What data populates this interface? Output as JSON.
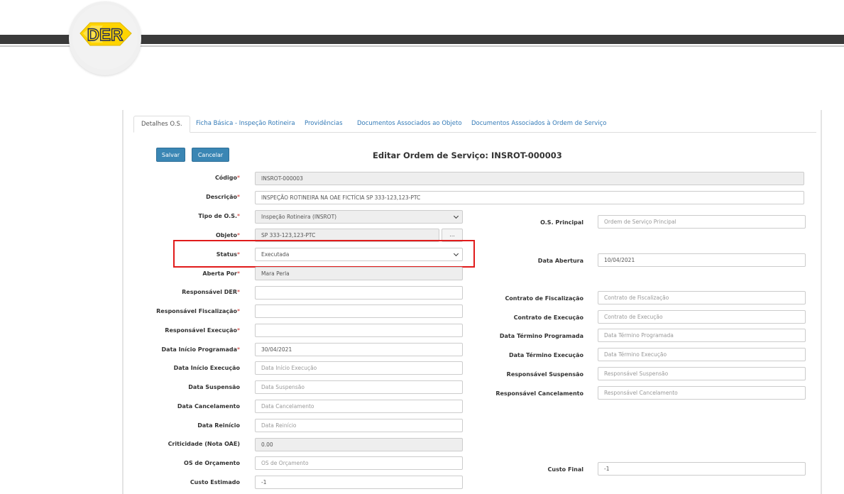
{
  "header": {
    "logo_text": "DER"
  },
  "tabs": [
    {
      "label": "Detalhes O.S."
    },
    {
      "label": "Ficha Básica - Inspeção Rotineira"
    },
    {
      "label": "Providências"
    },
    {
      "label": "Documentos Associados ao Objeto"
    },
    {
      "label": "Documentos Associados à Ordem de Serviço"
    }
  ],
  "toolbar": {
    "save_label": "Salvar",
    "cancel_label": "Cancelar"
  },
  "form": {
    "title": "Editar Ordem de Serviço: INSROT-000003",
    "codigo": {
      "label": "Código",
      "value": "INSROT-000003"
    },
    "descricao": {
      "label": "Descrição",
      "value": "INSPEÇÃO ROTINEIRA NA OAE FICTÍCIA SP 333-123,123-PTC"
    },
    "tipo_os": {
      "label": "Tipo de O.S.",
      "value": "Inspeção Rotineira (INSROT)"
    },
    "objeto": {
      "label": "Objeto",
      "value": "SP 333-123,123-PTC",
      "button": "..."
    },
    "status": {
      "label": "Status",
      "value": "Executada"
    },
    "aberta_por": {
      "label": "Aberta Por",
      "value": "Mara Perla"
    },
    "responsavel_der": {
      "label": "Responsável DER",
      "value": ""
    },
    "responsavel_fiscalizacao": {
      "label": "Responsável Fiscalização",
      "value": ""
    },
    "responsavel_execucao": {
      "label": "Responsável Execução",
      "value": ""
    },
    "data_inicio_programada": {
      "label": "Data Início Programada",
      "value": "30/04/2021"
    },
    "data_inicio_execucao": {
      "label": "Data Início Execução",
      "placeholder": "Data Início Execução"
    },
    "data_suspensao": {
      "label": "Data Suspensão",
      "placeholder": "Data Suspensão"
    },
    "data_cancelamento": {
      "label": "Data Cancelamento",
      "placeholder": "Data Cancelamento"
    },
    "data_reinicio": {
      "label": "Data Reinício",
      "placeholder": "Data Reinício"
    },
    "criticidade": {
      "label": "Criticidade (Nota OAE)",
      "value": "0.00"
    },
    "os_orcamento": {
      "label": "OS de Orçamento",
      "placeholder": "OS de Orçamento"
    },
    "custo_estimado": {
      "label": "Custo Estimado",
      "value": "-1"
    },
    "os_principal": {
      "label": "O.S. Principal",
      "placeholder": "Ordem de Serviço Principal"
    },
    "data_abertura": {
      "label": "Data Abertura",
      "value": "10/04/2021"
    },
    "contrato_fiscalizacao": {
      "label": "Contrato de Fiscalização",
      "placeholder": "Contrato de Fiscalização"
    },
    "contrato_execucao": {
      "label": "Contrato de Execução",
      "placeholder": "Contrato de Execução"
    },
    "data_termino_programada": {
      "label": "Data Término Programada",
      "placeholder": "Data Término Programada"
    },
    "data_termino_execucao": {
      "label": "Data Término Execução",
      "placeholder": "Data Término Execução"
    },
    "responsavel_suspensao": {
      "label": "Responsável Suspensão",
      "placeholder": "Responsável Suspensão"
    },
    "responsavel_cancelamento": {
      "label": "Responsável Cancelamento",
      "placeholder": "Responsável Cancelamento"
    },
    "custo_final": {
      "label": "Custo Final",
      "value": "-1"
    },
    "required_marker": "*"
  },
  "colors": {
    "accent": "#3a86b4",
    "highlight": "#e11b1b",
    "required": "#c9302c",
    "header_bar": "#3a3a3a"
  }
}
